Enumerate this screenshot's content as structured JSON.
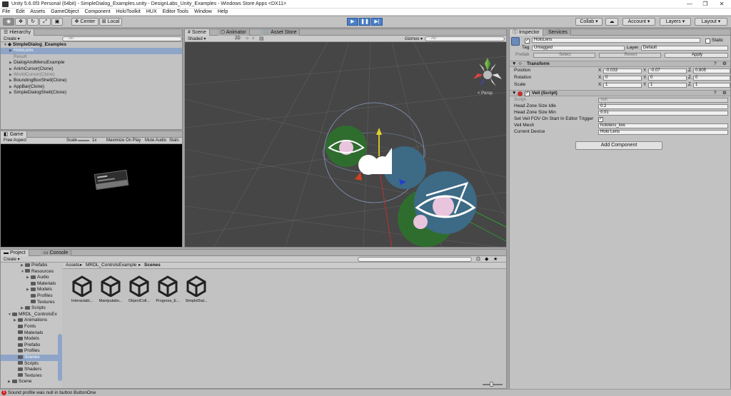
{
  "window": {
    "title": "Unity 5.6.0f3 Personal (64bit) - SimpleDialog_Examples.unity - DesignLabs_Unity_Examples - Windows Store Apps <DX11>"
  },
  "menu": [
    "File",
    "Edit",
    "Assets",
    "GameObject",
    "Component",
    "HoloToolkit",
    "HUX",
    "Editor Tools",
    "Window",
    "Help"
  ],
  "toolbar": {
    "center": "Center",
    "local": "Local",
    "collab": "Collab",
    "account": "Account",
    "layers": "Layers",
    "layout": "Layout"
  },
  "hierarchy": {
    "tab": "Hierarchy",
    "create": "Create",
    "search": "All",
    "scene": "SimpleDialog_Examples",
    "items": [
      {
        "label": "HoloLens",
        "state": "selected"
      },
      {
        "label": "Result",
        "state": "dim"
      },
      {
        "label": "DialogAndMenuExample",
        "state": "normal"
      },
      {
        "label": "AnimCursor(Clone)",
        "state": "normal"
      },
      {
        "label": "WorldCursor(Clone)",
        "state": "dim"
      },
      {
        "label": "BoundingBoxShell(Clone)",
        "state": "normal"
      },
      {
        "label": "AppBar(Clone)",
        "state": "normal"
      },
      {
        "label": "SimpleDialogShell(Clone)",
        "state": "normal"
      }
    ]
  },
  "game": {
    "tab": "Game",
    "aspect": "Free Aspect",
    "scale": "Scale",
    "scale_val": "1x",
    "maximize": "Maximize On Play",
    "mute": "Mute Audio",
    "stats": "Stats"
  },
  "scene": {
    "tabs": [
      "Scene",
      "Animator",
      "Asset Store"
    ],
    "shaded": "Shaded",
    "twod": "2D",
    "gizmos": "Gizmos",
    "search": "All",
    "persp": "< Persp"
  },
  "inspector": {
    "tabs": [
      "Inspector",
      "Services"
    ],
    "name": "HoloLens",
    "static": "Static",
    "tag_label": "Tag",
    "tag": "Untagged",
    "layer_label": "Layer",
    "layer": "Default",
    "prefab_label": "Prefab",
    "prefab_select": "Select",
    "prefab_revert": "Revert",
    "prefab_apply": "Apply",
    "transform": {
      "title": "Transform",
      "rows": [
        {
          "label": "Position",
          "x": "-0.033",
          "y": "-0.07",
          "z": "0.805"
        },
        {
          "label": "Rotation",
          "x": "0",
          "y": "0",
          "z": "0"
        },
        {
          "label": "Scale",
          "x": "1",
          "y": "1",
          "z": "1"
        }
      ],
      "axis_x": "X",
      "axis_y": "Y",
      "axis_z": "Z"
    },
    "veil": {
      "title": "Veil (Script)",
      "rows": [
        {
          "label": "Script",
          "value": "Veil"
        },
        {
          "label": "Head Zone Size Idle",
          "value": "0.2"
        },
        {
          "label": "Head Zone Size Min",
          "value": "0.01"
        },
        {
          "label": "Set Veil FOV On Start In Editor Trigger",
          "value": "✓"
        },
        {
          "label": "Veil Mesh",
          "value": "hololens_low"
        },
        {
          "label": "Current Device",
          "value": "Holo Lens"
        }
      ]
    },
    "add_component": "Add Component"
  },
  "project": {
    "tabs": [
      "Project",
      "Console"
    ],
    "create": "Create",
    "tree": [
      {
        "label": "Prefabs",
        "depth": 2
      },
      {
        "label": "Resources",
        "depth": 2
      },
      {
        "label": "Audio",
        "depth": 3
      },
      {
        "label": "Materials",
        "depth": 3
      },
      {
        "label": "Models",
        "depth": 3
      },
      {
        "label": "Profiles",
        "depth": 3
      },
      {
        "label": "Textures",
        "depth": 3
      },
      {
        "label": "Scripts",
        "depth": 2
      },
      {
        "label": "MRDL_ControlsEx",
        "depth": 1
      },
      {
        "label": "Animations",
        "depth": 2
      },
      {
        "label": "Fonts",
        "depth": 2
      },
      {
        "label": "Materials",
        "depth": 2
      },
      {
        "label": "Models",
        "depth": 2
      },
      {
        "label": "Prefabs",
        "depth": 2
      },
      {
        "label": "Profiles",
        "depth": 2
      },
      {
        "label": "Scenes",
        "depth": 2
      },
      {
        "label": "Scripts",
        "depth": 2
      },
      {
        "label": "Shaders",
        "depth": 2
      },
      {
        "label": "Textures",
        "depth": 2
      },
      {
        "label": "Scene",
        "depth": 1
      }
    ],
    "breadcrumb": [
      "Assets",
      "MRDL_ControlsExample",
      "Scenes"
    ],
    "assets": [
      "Interactabl...",
      "Manipulatio...",
      "ObjectColl...",
      "Progress_E...",
      "SimpleDial..."
    ]
  },
  "status": {
    "message": "Sound profile was null in button ButtonOne"
  },
  "colors": {
    "selection": "#8ea5c8",
    "scene_bg": "#464646",
    "play_blue": "#4a7fc8",
    "error": "#d02020"
  }
}
